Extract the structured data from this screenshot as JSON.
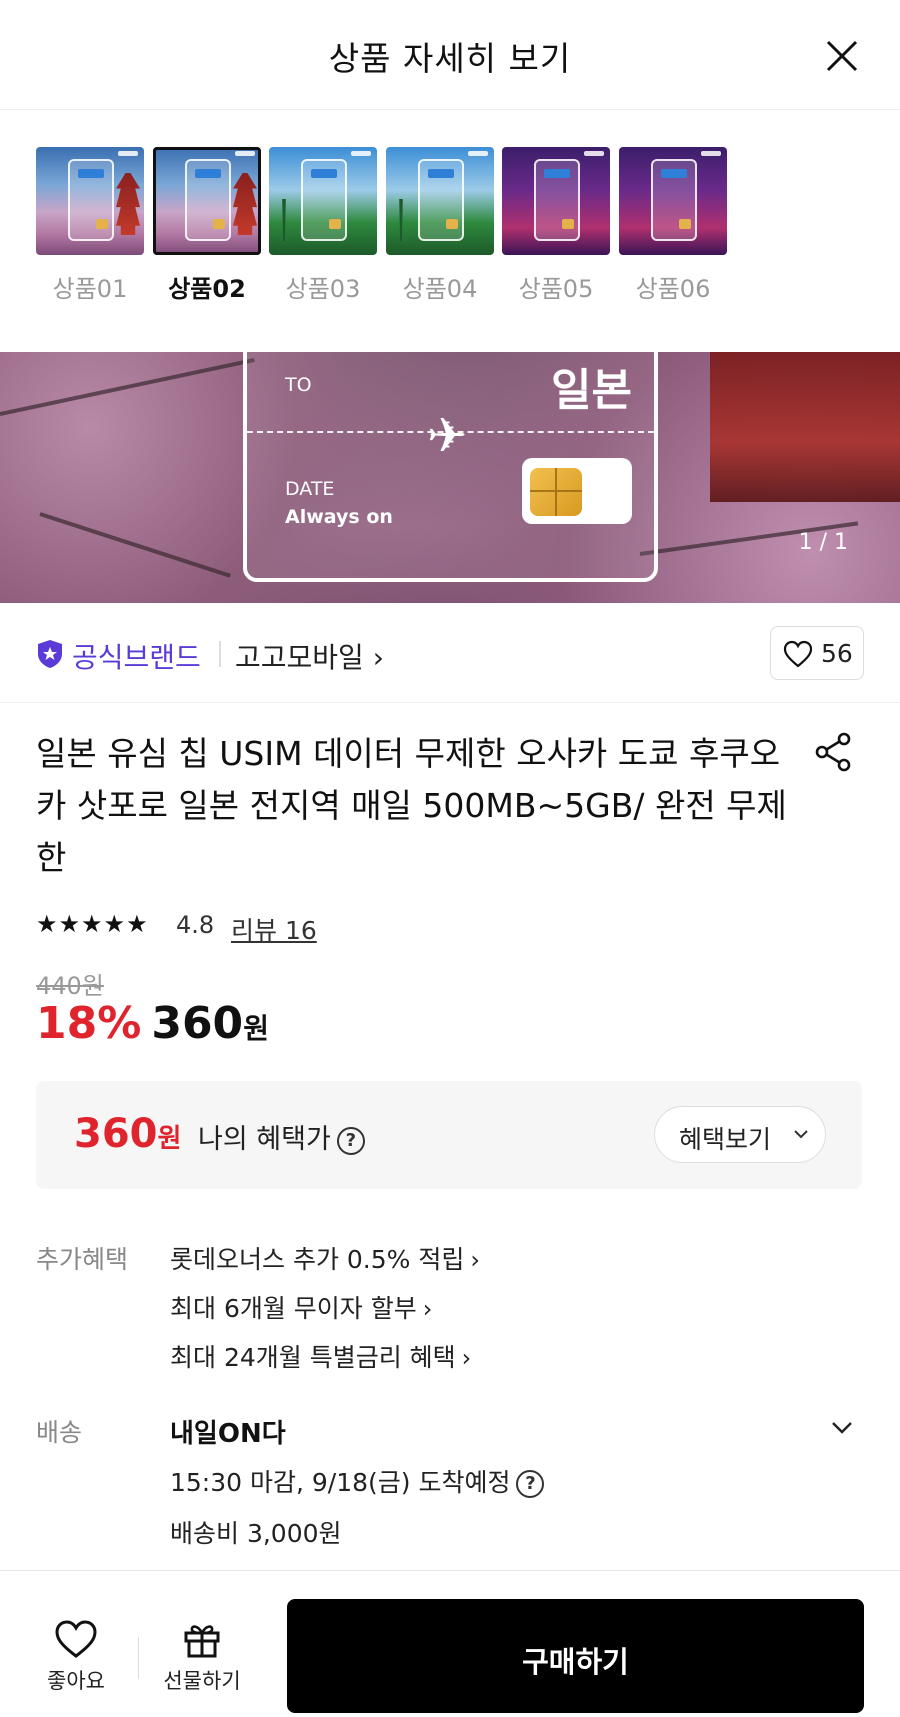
{
  "header": {
    "title": "상품 자세히 보기"
  },
  "thumbnails": [
    {
      "label": "상품01",
      "selected": false,
      "theme": "japan",
      "tag": "eSIM"
    },
    {
      "label": "상품02",
      "selected": true,
      "theme": "japan",
      "tag": "USIM"
    },
    {
      "label": "상품03",
      "selected": false,
      "theme": "vietnam",
      "tag": "eSIM"
    },
    {
      "label": "상품04",
      "selected": false,
      "theme": "vietnam",
      "tag": "USIM"
    },
    {
      "label": "상품05",
      "selected": false,
      "theme": "china",
      "tag": "eSIM"
    },
    {
      "label": "상품06",
      "selected": false,
      "theme": "china",
      "tag": "USIM"
    }
  ],
  "hero": {
    "to_label": "TO",
    "country": "일본",
    "date_label": "DATE",
    "date_value": "Always on",
    "counter": "1 / 1"
  },
  "brand": {
    "badge_label": "공식브랜드",
    "store_name": "고고모바일 ›",
    "like_count": "56"
  },
  "product": {
    "title": "일본 유심 칩 USIM 데이터 무제한 오사카 도쿄 후쿠오카 삿포로 일본 전지역 매일 500MB~5GB/ 완전 무제한",
    "stars": "★★★★★",
    "rating": "4.8",
    "review_link": "리뷰 16",
    "original_price": "440원",
    "discount": "18%",
    "price": "360",
    "price_unit": "원"
  },
  "benefit": {
    "price": "360",
    "price_unit": "원",
    "label": "나의 혜택가",
    "help": "?",
    "button": "혜택보기"
  },
  "extra_benefits": {
    "label": "추가혜택",
    "items": [
      "롯데오너스 추가 0.5% 적립",
      "최대 6개월 무이자 할부",
      "최대 24개월 특별금리 혜택"
    ],
    "chevron": "›"
  },
  "shipping": {
    "label": "배송",
    "title": "내일ON다",
    "deadline": "15:30 마감, 9/18(금) 도착예정",
    "help": "?",
    "fee": "배송비 3,000원"
  },
  "bottom_bar": {
    "like_label": "좋아요",
    "gift_label": "선물하기",
    "buy_label": "구매하기"
  },
  "colors": {
    "accent_red": "#e0242e",
    "brand_purple": "#5a3bd8",
    "buy_button": "#000000"
  }
}
